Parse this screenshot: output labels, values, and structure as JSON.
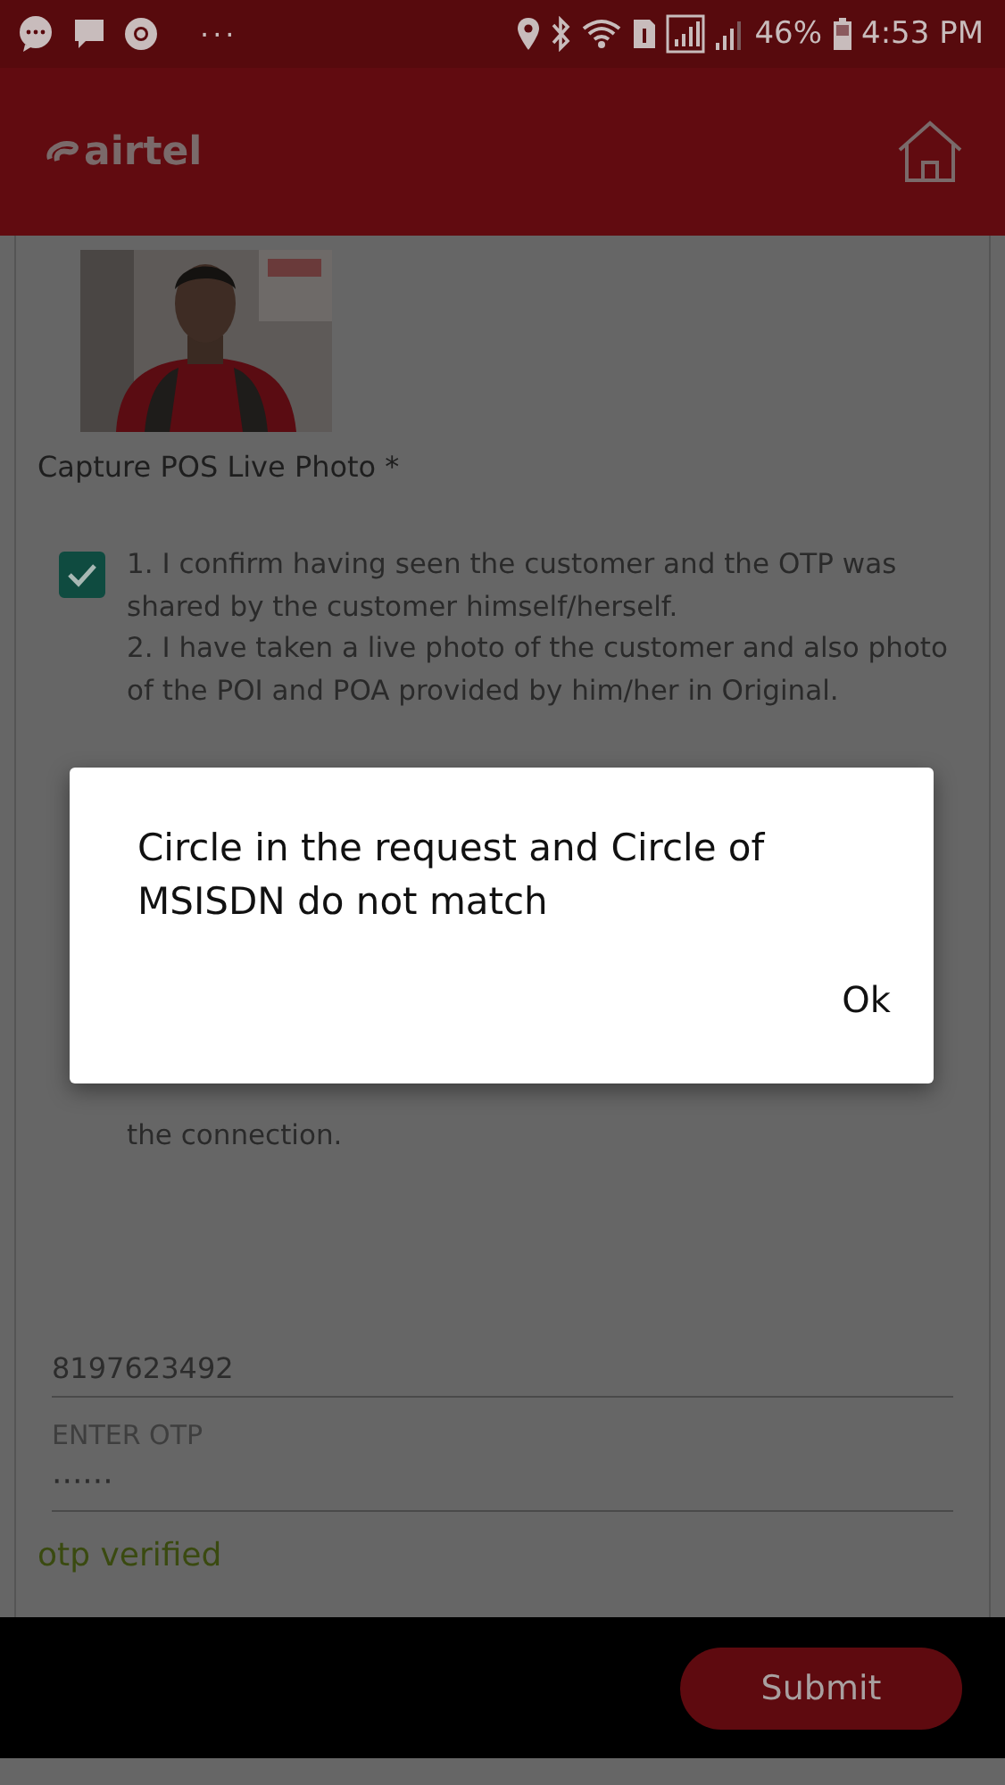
{
  "status_bar": {
    "battery": "46%",
    "time": "4:53 PM",
    "more": "···"
  },
  "header": {
    "logo": "airtel"
  },
  "photo": {
    "kind": "picture",
    "caption": "Capture POS Live Photo *"
  },
  "declaration": {
    "checked": true,
    "items": [
      "1. I confirm having seen the customer and the OTP was shared by the customer himself/herself.",
      "2. I have taken a live photo of the customer and also photo of the POI and POA provided by him/her in Original."
    ],
    "tail": "the connection."
  },
  "fields": [
    {
      "value": "8197623492"
    },
    {
      "label": "ENTER OTP",
      "placeholder": "······"
    }
  ],
  "otp_status": "otp verified",
  "submit": "Submit",
  "dialog": {
    "message": "Circle in the request and Circle of MSISDN do not match",
    "button": "Ok"
  }
}
